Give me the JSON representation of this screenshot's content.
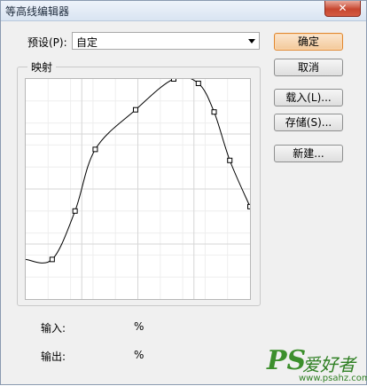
{
  "window": {
    "title": "等高线编辑器",
    "close_icon": "close-icon"
  },
  "preset": {
    "label": "预设(P):",
    "value": "自定"
  },
  "mapping": {
    "label": "映射",
    "curve_points": [
      [
        0,
        0.18
      ],
      [
        0.118,
        0.18
      ],
      [
        0.22,
        0.4
      ],
      [
        0.31,
        0.68
      ],
      [
        0.49,
        0.86
      ],
      [
        0.66,
        1.0
      ],
      [
        0.77,
        0.98
      ],
      [
        0.84,
        0.85
      ],
      [
        0.91,
        0.63
      ],
      [
        1.0,
        0.42
      ]
    ]
  },
  "fields": {
    "input_label": "输入:",
    "input_unit": "%",
    "output_label": "输出:",
    "output_unit": "%"
  },
  "buttons": {
    "ok": "确定",
    "cancel": "取消",
    "load": "载入(L)...",
    "save": "存储(S)...",
    "new": "新建..."
  },
  "watermark": {
    "ps": "PS",
    "text": "爱好者",
    "url": "www.psahz.com"
  },
  "colors": {
    "default_button": "#f3c99a",
    "watermark": "#3c8f2c"
  }
}
